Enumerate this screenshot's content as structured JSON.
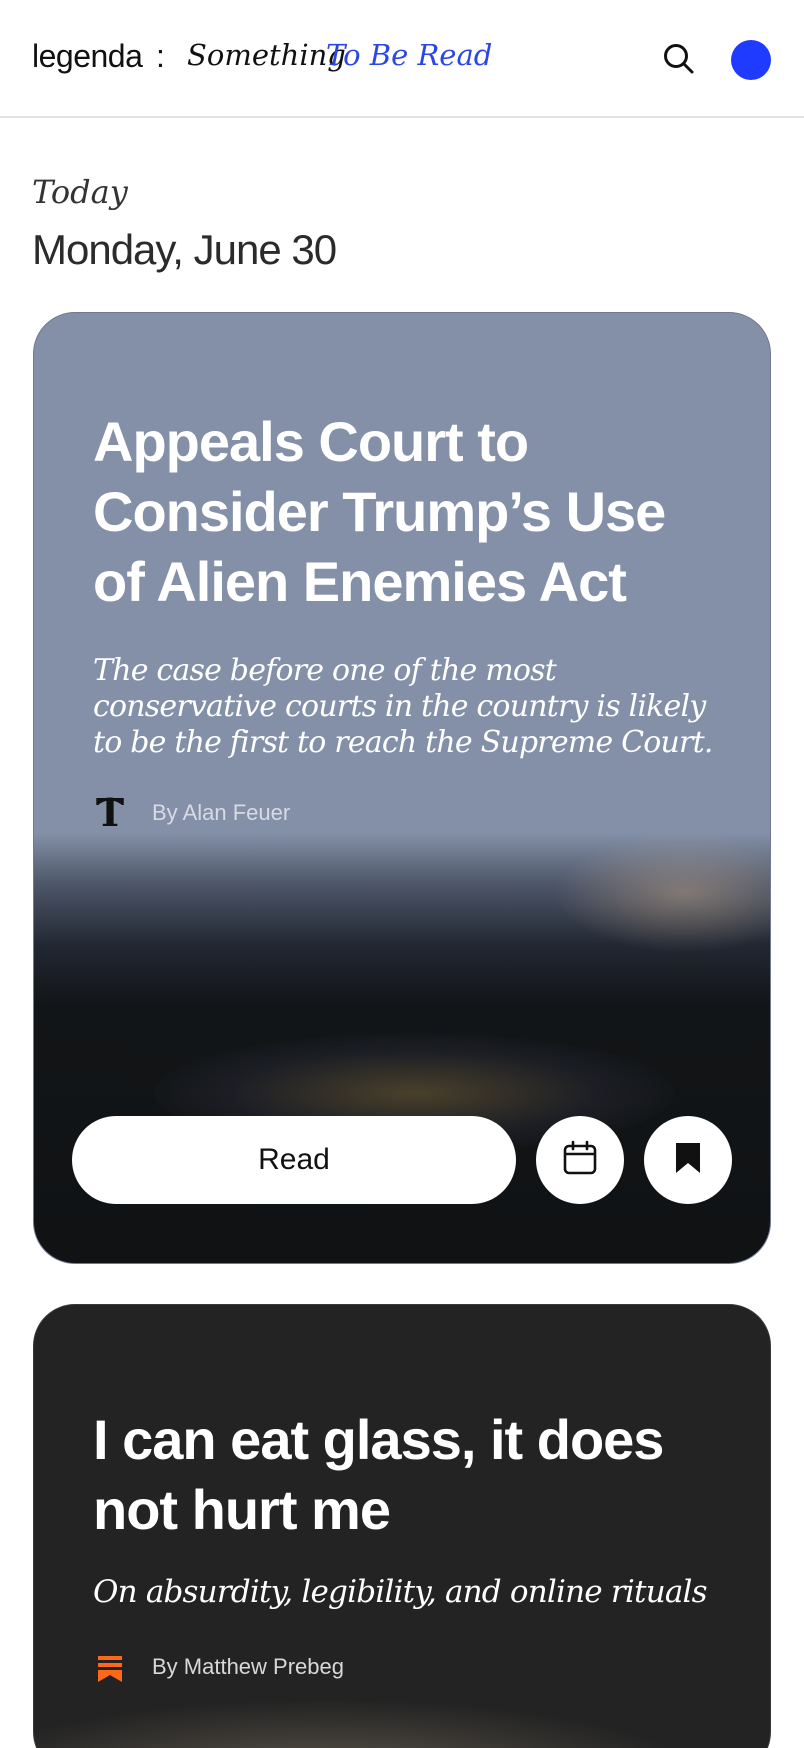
{
  "header": {
    "brand": "legenda",
    "separator": ":",
    "tagline_part1": "Something",
    "tagline_part2": "To Be Read",
    "tagline_accent_color": "#2a47e6",
    "search_icon": "search-icon",
    "avatar_color": "#1f3bff"
  },
  "section": {
    "label": "Today",
    "date": "Monday, June 30"
  },
  "articles": [
    {
      "headline": "Appeals Court to Consider Trump’s Use of Alien Enemies Act",
      "dek": "The case before one of the most conservative courts in the country is likely to be the first to reach the Supreme Court.",
      "source_icon": "nyt-logo-icon",
      "byline": "By Alan Feuer",
      "card_color": "#8390a7",
      "actions": {
        "read_label": "Read",
        "schedule_icon": "calendar-icon",
        "save_icon": "bookmark-icon"
      }
    },
    {
      "headline": "I can eat glass, it does not hurt me",
      "dek": "On absurdity, legibility, and online rituals",
      "source_icon": "substack-logo-icon",
      "source_color": "#ff6719",
      "byline": "By Matthew Prebeg",
      "card_color": "#232323"
    }
  ]
}
